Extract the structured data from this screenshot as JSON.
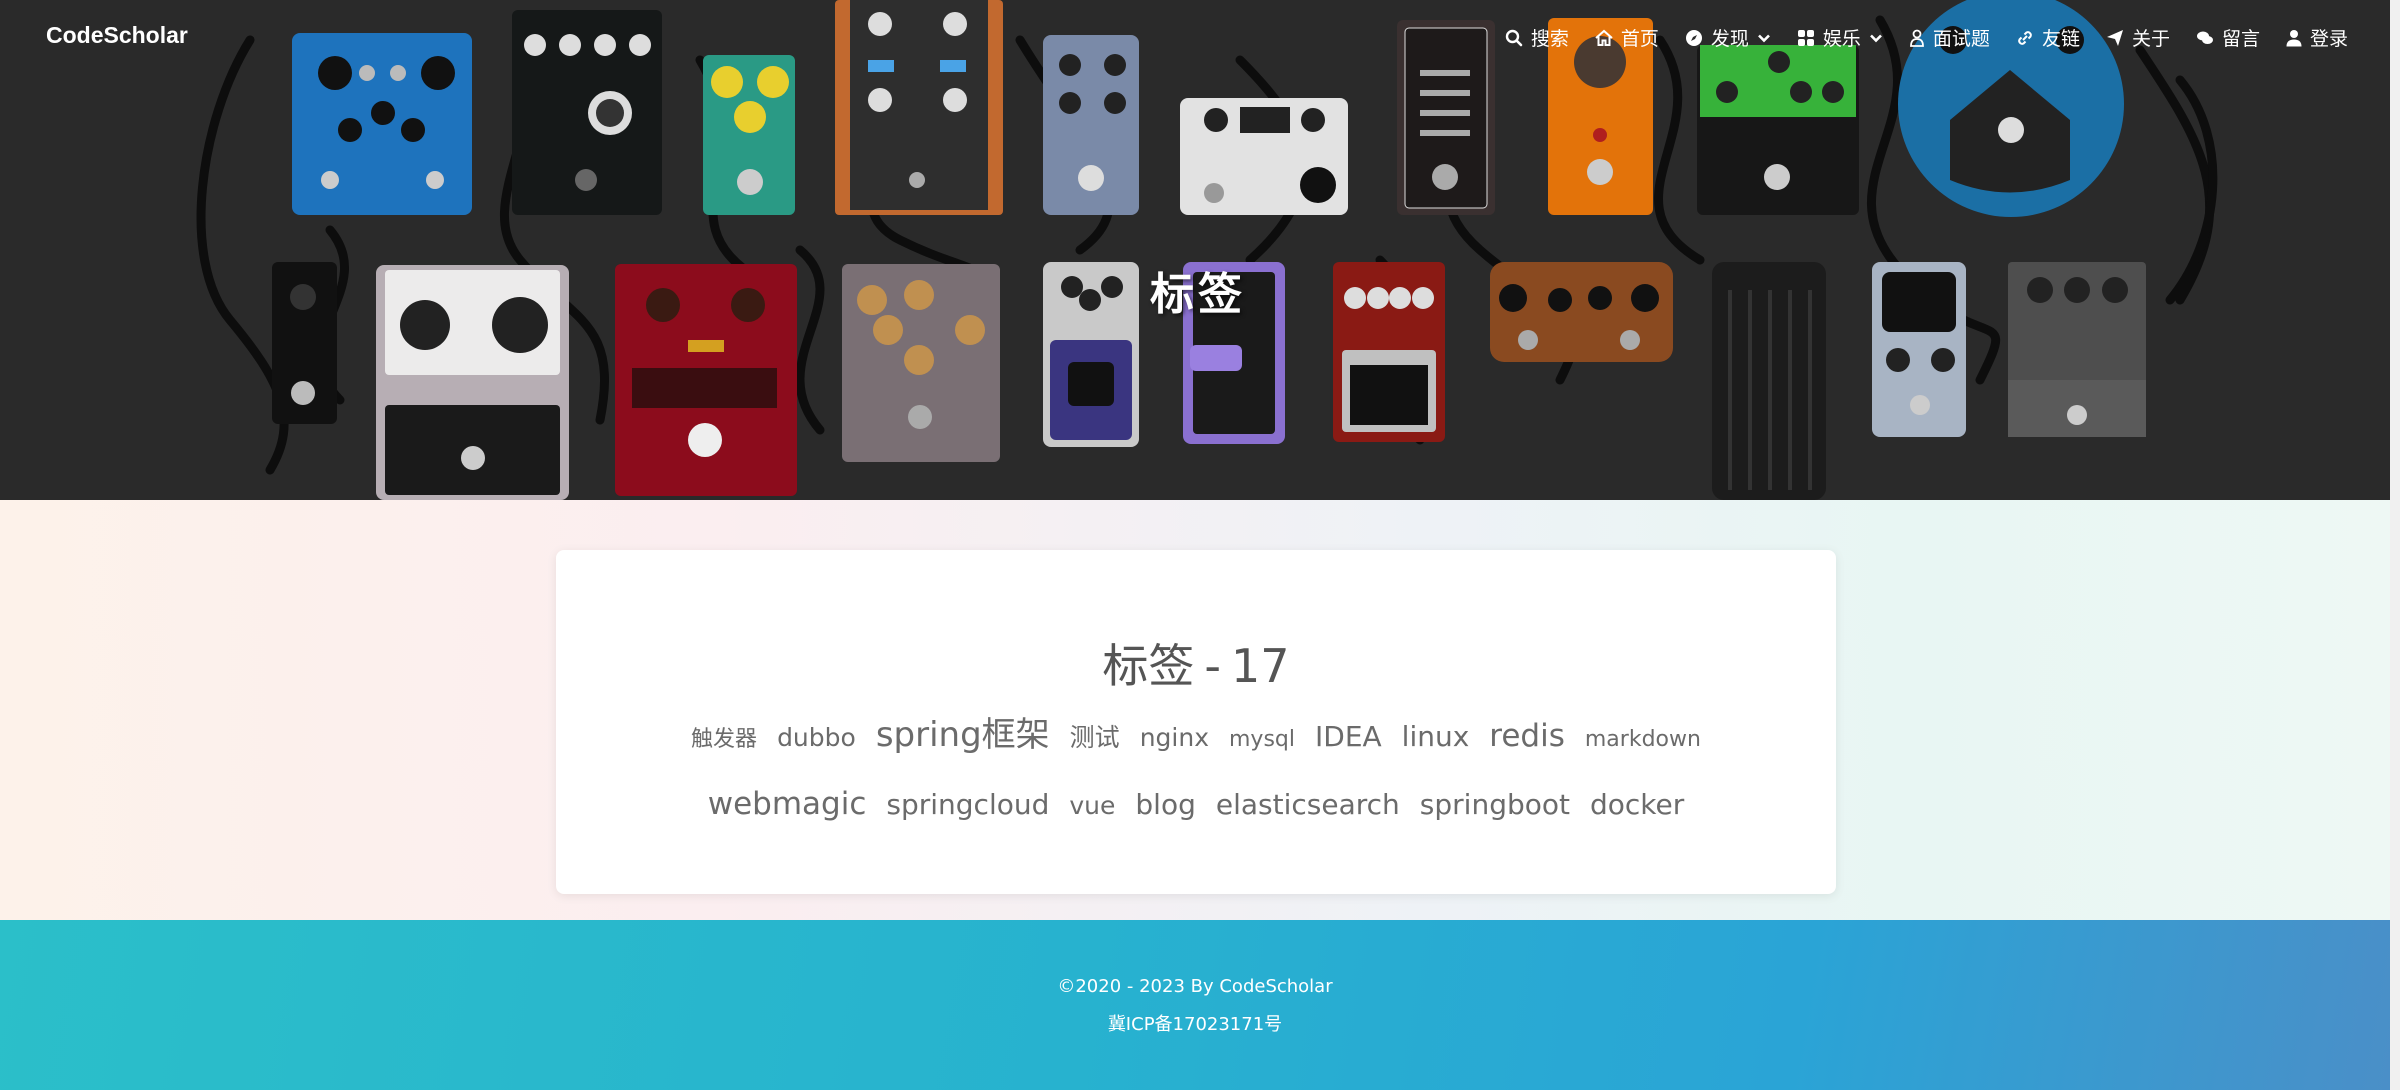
{
  "brand": "CodeScholar",
  "nav": {
    "search": "搜索",
    "home": "首页",
    "discover": "发现",
    "entertainment": "娱乐",
    "interview": "面试题",
    "links": "友链",
    "about": "关于",
    "message": "留言",
    "login": "登录"
  },
  "hero": {
    "title": "标签"
  },
  "card": {
    "title_label": "标签",
    "title_sep": "-",
    "title_count": "17"
  },
  "tags": [
    {
      "name": "触发器"
    },
    {
      "name": "dubbo"
    },
    {
      "name": "spring框架"
    },
    {
      "name": "测试"
    },
    {
      "name": "nginx"
    },
    {
      "name": "mysql"
    },
    {
      "name": "IDEA"
    },
    {
      "name": "linux"
    },
    {
      "name": "redis"
    },
    {
      "name": "markdown"
    },
    {
      "name": "webmagic"
    },
    {
      "name": "springcloud"
    },
    {
      "name": "vue"
    },
    {
      "name": "blog"
    },
    {
      "name": "elasticsearch"
    },
    {
      "name": "springboot"
    },
    {
      "name": "docker"
    }
  ],
  "footer": {
    "copyright": "©2020 - 2023 By CodeScholar",
    "icp": "冀ICP备17023171号"
  }
}
